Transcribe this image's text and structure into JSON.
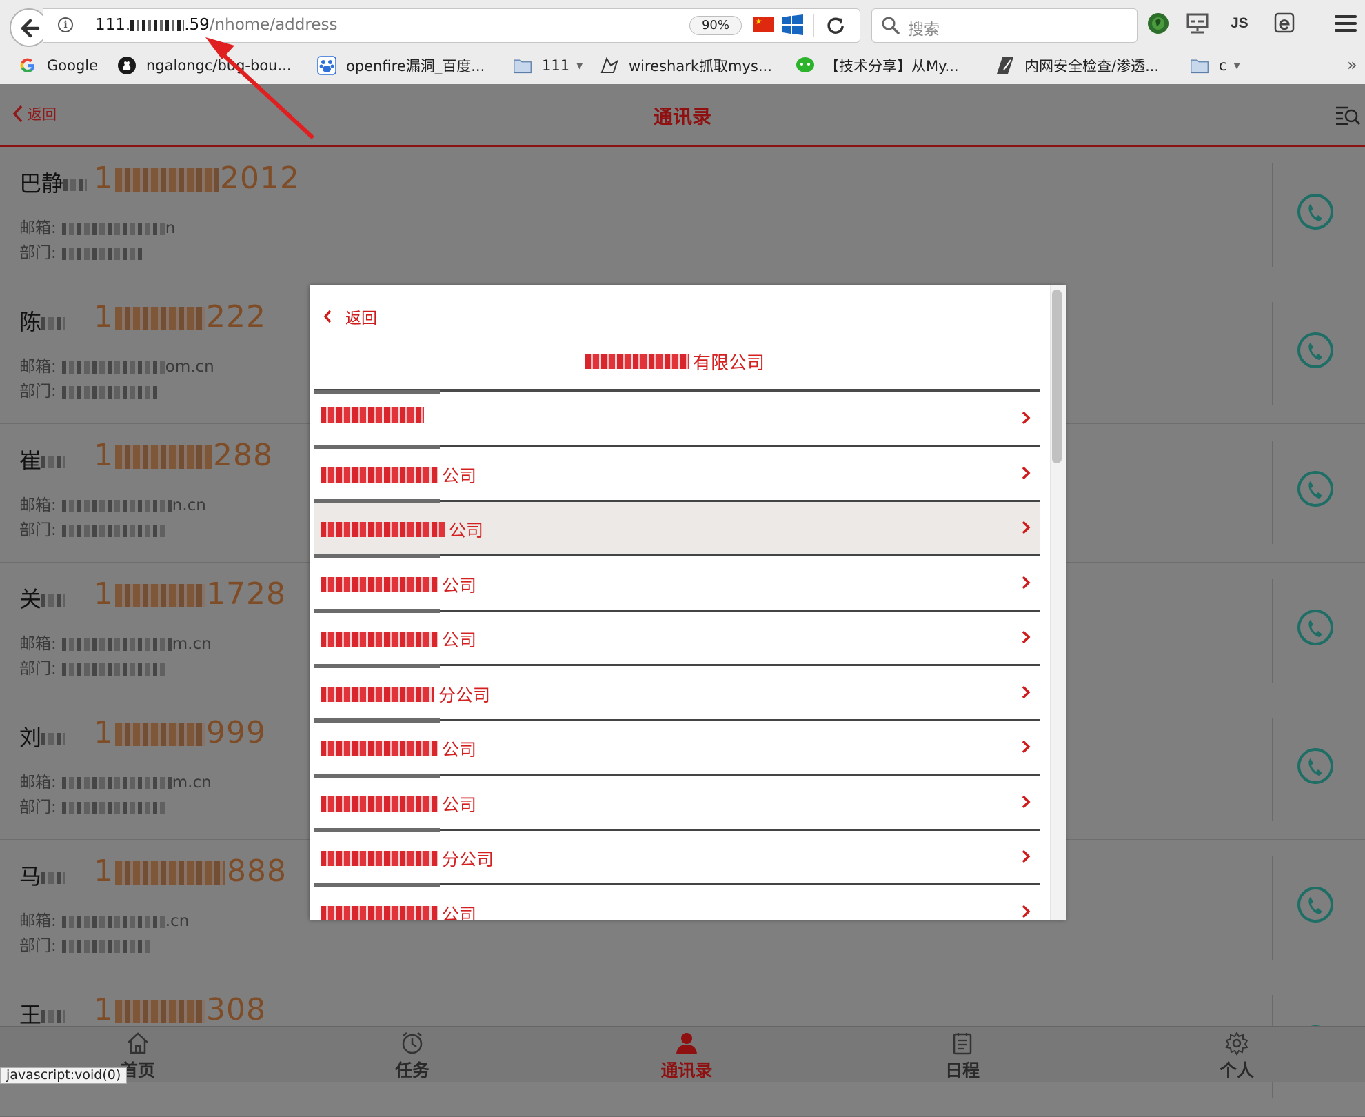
{
  "browser": {
    "url_host": "111.",
    "url_host_tail": ".59",
    "url_path": "/nhome/address",
    "zoom": "90%",
    "search_placeholder": "搜索",
    "js_label": "JS"
  },
  "bookmarks": [
    {
      "label": "Google",
      "icon": "google-icon"
    },
    {
      "label": "ngalongc/bug-bou...",
      "icon": "github-icon"
    },
    {
      "label": "openfire漏洞_百度...",
      "icon": "baidu-icon"
    },
    {
      "label": "111",
      "icon": "folder-icon"
    },
    {
      "label": "wireshark抓取mys...",
      "icon": "shark-icon"
    },
    {
      "label": "【技术分享】从My...",
      "icon": "wechat-icon"
    },
    {
      "label": "内网安全检查/渗透...",
      "icon": "zhihu-icon"
    },
    {
      "label": "c",
      "icon": "folder-icon"
    }
  ],
  "app": {
    "back_label": "返回",
    "title": "通讯录"
  },
  "contacts": [
    {
      "name": "巴静",
      "phone_head": "1",
      "phone_tail": "2012",
      "email_label": "邮箱:",
      "email_tail": "n",
      "dept_label": "部门:"
    },
    {
      "name": "陈",
      "phone_head": "1",
      "phone_tail": "222",
      "email_label": "邮箱:",
      "email_tail": "om.cn",
      "dept_label": "部门:"
    },
    {
      "name": "崔",
      "phone_head": "1",
      "phone_tail": "288",
      "email_label": "邮箱:",
      "email_tail": "n.cn",
      "dept_label": "部门:"
    },
    {
      "name": "关",
      "phone_head": "1",
      "phone_tail": "1728",
      "email_label": "邮箱:",
      "email_tail": "m.cn",
      "dept_label": "部门:"
    },
    {
      "name": "刘",
      "phone_head": "1",
      "phone_tail": "999",
      "email_label": "邮箱:",
      "email_tail": "m.cn",
      "dept_label": "部门:"
    },
    {
      "name": "马",
      "phone_head": "1",
      "phone_tail": "888",
      "email_label": "邮箱:",
      "email_tail": ".cn",
      "dept_label": "部门:"
    },
    {
      "name": "王",
      "phone_head": "1",
      "phone_tail": "308",
      "email_label": "",
      "email_tail": "",
      "dept_label": ""
    }
  ],
  "modal": {
    "back_label": "返回",
    "title_suffix": "有限公司",
    "items": [
      {
        "suffix": ""
      },
      {
        "suffix": "公司"
      },
      {
        "suffix": "公司",
        "highlighted": true
      },
      {
        "suffix": "公司"
      },
      {
        "suffix": "公司"
      },
      {
        "suffix": "分公司"
      },
      {
        "suffix": "公司"
      },
      {
        "suffix": "公司"
      },
      {
        "suffix": "分公司"
      },
      {
        "suffix": "公司"
      }
    ]
  },
  "tabs": [
    {
      "label": "首页",
      "icon": "home-icon"
    },
    {
      "label": "任务",
      "icon": "alarm-icon"
    },
    {
      "label": "通讯录",
      "icon": "contacts-icon",
      "active": true
    },
    {
      "label": "日程",
      "icon": "schedule-icon"
    },
    {
      "label": "个人",
      "icon": "settings-icon"
    }
  ],
  "status_bar": "javascript:void(0)",
  "colors": {
    "brand_red": "#d42020",
    "dark_red": "#8e1010",
    "phone_orange": "#7e4d27",
    "call_green": "#1f6e66"
  }
}
